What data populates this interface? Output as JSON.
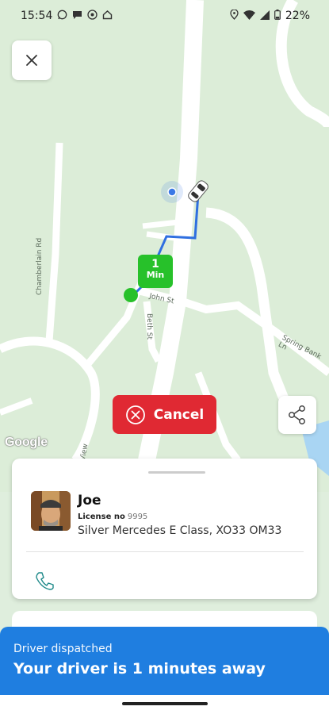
{
  "status_bar": {
    "time": "15:54",
    "battery": "22%",
    "left_icons": [
      "whatsapp-icon",
      "chat-bubble-icon",
      "messenger-icon",
      "home-icon"
    ],
    "right_icons": [
      "location-pin-icon",
      "wifi-icon",
      "signal-icon",
      "battery-icon"
    ]
  },
  "map": {
    "streets": [
      "Chamberlain Rd",
      "John St",
      "Beth St",
      "Spring Bank Ln",
      "View"
    ],
    "attribution": "Google",
    "eta_badge": {
      "value": "1",
      "unit": "Min"
    },
    "route_color": "#2f6fe0",
    "car_icon": "car-icon"
  },
  "buttons": {
    "close": "close-icon",
    "share": "share-icon",
    "cancel_label": "Cancel"
  },
  "driver": {
    "name": "Joe",
    "license_label": "License no",
    "license_number": "9995",
    "vehicle": "Silver Mercedes E Class, XO33 OM33"
  },
  "notice": {
    "title": "Driver dispatched",
    "message": "Your driver is 1 minutes away",
    "color": "#1f7ee0"
  },
  "colors": {
    "cancel": "#e02933",
    "eta": "#27c12a",
    "map_background": "#dcedd8"
  }
}
